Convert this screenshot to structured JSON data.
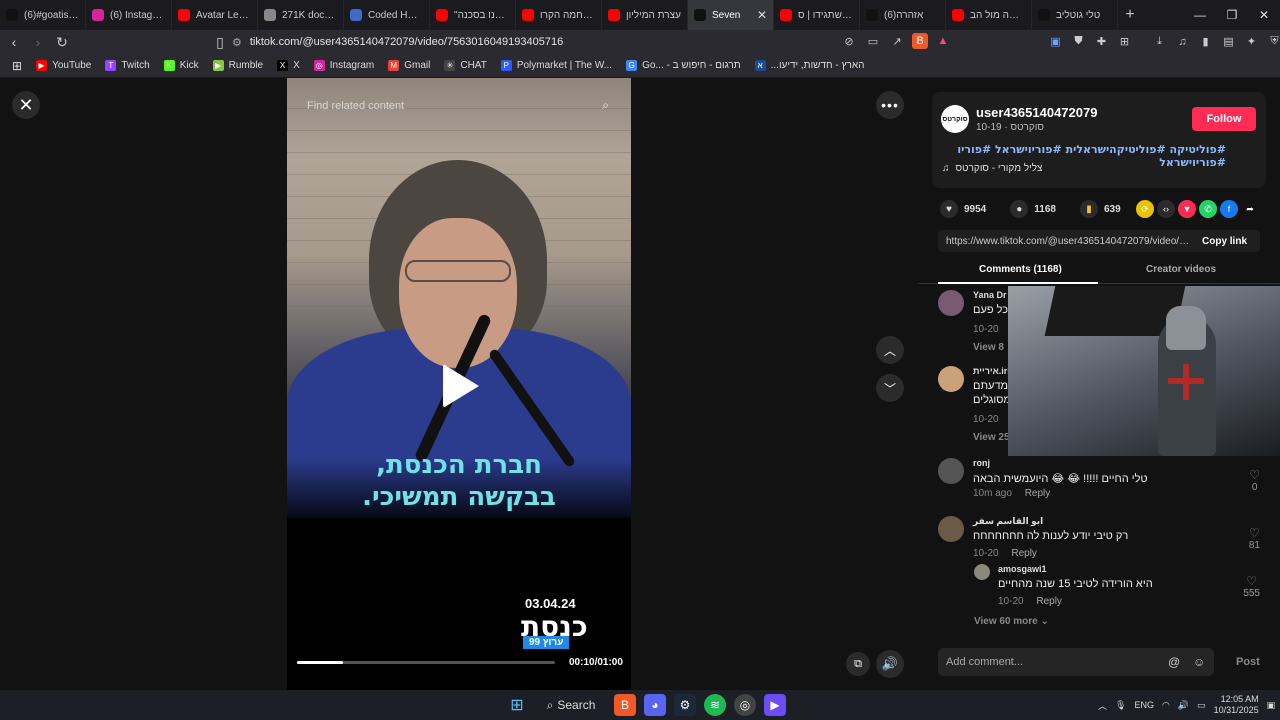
{
  "browser": {
    "tabs": [
      {
        "title": "(6)#goatis #fyp",
        "fav": "tiktok",
        "color": "#111"
      },
      {
        "title": "(6) Instagram",
        "fav": "instagram",
        "color": "#d6249f"
      },
      {
        "title": "Avatar Legends",
        "fav": "youtube",
        "color": "#ff0000"
      },
      {
        "title": "271K documen",
        "fav": "chrome",
        "color": "#888"
      },
      {
        "title": "Coded Hate: Ea",
        "fav": "web",
        "color": "#3a6cc8"
      },
      {
        "title": "\"אנחנו בסכנה",
        "fav": "youtube",
        "color": "#ff0000"
      },
      {
        "title": "המלחמה הקרו",
        "fav": "youtube",
        "color": "#ff0000"
      },
      {
        "title": "עצרת המיליון",
        "fav": "youtube",
        "color": "#ff0000"
      },
      {
        "title": "Seven",
        "fav": "tiktok",
        "color": "#111",
        "active": true
      },
      {
        "title": "מה שתגידו | ס",
        "fav": "youtube",
        "color": "#ff0000"
      },
      {
        "title": "(6)אזהרה",
        "fav": "tiktok",
        "color": "#111"
      },
      {
        "title": "מחאה מול הב",
        "fav": "youtube",
        "color": "#ff0000"
      },
      {
        "title": "טלי גוטליב",
        "fav": "tiktok",
        "color": "#111"
      }
    ],
    "new_tab": "+",
    "url": "tiktok.com/@user4365140472079/video/7563016049193405716",
    "bookmarks": [
      {
        "label": "YouTube",
        "color": "#ff0000",
        "glyph": "▶"
      },
      {
        "label": "Twitch",
        "color": "#9146ff",
        "glyph": "T"
      },
      {
        "label": "Kick",
        "color": "#53fc18",
        "glyph": "K"
      },
      {
        "label": "Rumble",
        "color": "#85c742",
        "glyph": "▶"
      },
      {
        "label": "X",
        "color": "#000",
        "glyph": "X"
      },
      {
        "label": "Instagram",
        "color": "#d6249f",
        "glyph": "◎"
      },
      {
        "label": "Gmail",
        "color": "#ea4335",
        "glyph": "M"
      },
      {
        "label": "CHAT",
        "color": "#444",
        "glyph": "✳"
      },
      {
        "label": "Polymarket | The W...",
        "color": "#2d5bff",
        "glyph": "P"
      },
      {
        "label": "Go... - תרגום - חיפוש ב",
        "color": "#4285f4",
        "glyph": "G"
      },
      {
        "label": "...הארץ - חדשות, ידיעו",
        "color": "#1a4c8f",
        "glyph": "א"
      }
    ]
  },
  "video": {
    "search_placeholder": "Find related content",
    "caption_line1": "חברת הכנסת,",
    "caption_line2": "בבקשה תמשיכי.",
    "logo_date": "03.04.24",
    "logo_name": "כנסת",
    "logo_channel": "ערוץ 99",
    "time": "00:10/01:00",
    "progress": 0.18
  },
  "author": {
    "avatar_text": "סוקרטס",
    "username": "user4365140472079",
    "subline": "סוקרטס · 10-19",
    "follow_label": "Follow",
    "hashtags": "#פוליטיקה #פוליטיקהישראלית #פוריוישראל #פוריו #פוריוישראל",
    "music": "צליל מקורי - סוקרטס"
  },
  "stats": {
    "likes": "9954",
    "comments": "1168",
    "saves": "639"
  },
  "link": {
    "url": "https://www.tiktok.com/@user4365140472079/video/7...",
    "copy_label": "Copy link"
  },
  "tabs": {
    "comments": "Comments (1168)",
    "creator": "Creator videos"
  },
  "comments": [
    {
      "name": "Yana Dr",
      "text": "כל פעם",
      "meta": "10-20",
      "views": "View 8",
      "avatar_color": "#7a5a6e"
    },
    {
      "name": "איריית.irit",
      "text": "מדעתם",
      "text2": "מסוגלים",
      "meta": "10-20",
      "views": "View 25",
      "avatar_color": "#c9a27a"
    },
    {
      "name": "ronj",
      "text": "טלי החיים !!!!! 😂 😂 היועמשית הבאה",
      "meta": "10m ago",
      "reply": "Reply",
      "likes": "0",
      "avatar_color": "#555"
    },
    {
      "name": "ابو القاسم سفر",
      "text": "רק טיבי יודע לענות לה חחחחחחח",
      "meta": "10-20",
      "reply": "Reply",
      "likes": "81",
      "avatar_color": "#6b5a48"
    },
    {
      "name": "amosgawi1",
      "text": "היא הורידה לטיבי 15 שנה מהחיים",
      "meta": "10-20",
      "reply": "Reply",
      "likes": "555",
      "avatar_color": "#8a8a7a"
    }
  ],
  "more_replies": "View 60 more",
  "add_comment_placeholder": "Add comment...",
  "post_label": "Post",
  "taskbar": {
    "search_label": "Search",
    "lang": "ENG",
    "time": "12:05 AM",
    "date": "10/31/2025"
  }
}
